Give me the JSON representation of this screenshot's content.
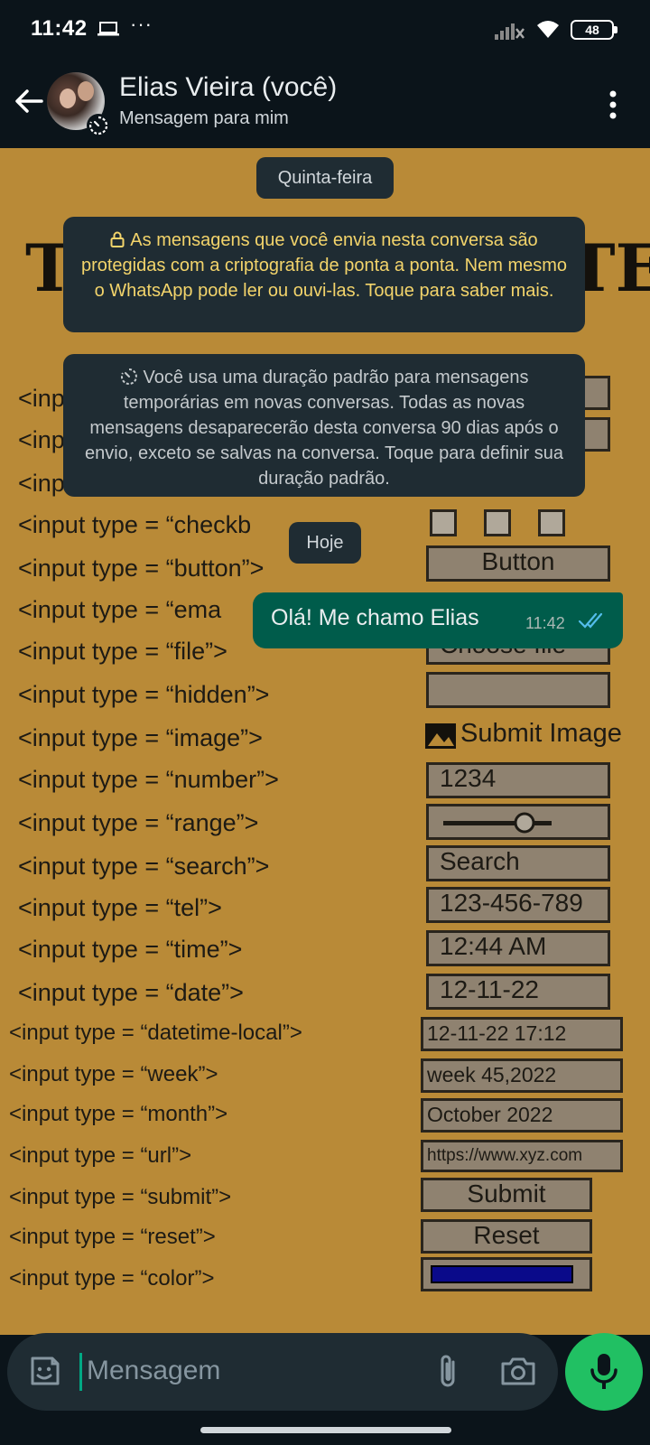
{
  "status_bar": {
    "time": "11:42",
    "dots": "···",
    "battery": "48",
    "icons": [
      "laptop-icon",
      "signal-off-icon",
      "wifi-icon",
      "battery-icon"
    ]
  },
  "header": {
    "contact_name": "Elias Vieira (você)",
    "subtitle": "Mensagem para mim",
    "icons": [
      "back-arrow-icon",
      "timer-icon",
      "more-vert-icon"
    ]
  },
  "chat": {
    "date_chip_1": "Quinta-feira",
    "encryption_notice": "As mensagens que você envia nesta conversa são protegidas com a criptografia de ponta a ponta. Nem mesmo o WhatsApp pode ler ou ouvi-las. Toque para saber mais.",
    "disappearing_notice": "Você usa uma duração padrão para mensagens temporárias em novas conversas. Todas as novas mensagens desaparecerão desta conversa 90 dias após o envio, exceto se salvas na conversa. Toque para definir sua duração padrão.",
    "date_chip_2": "Hoje",
    "messages": [
      {
        "text": "Olá! Me chamo Elias",
        "time": "11:42",
        "status": "read"
      }
    ]
  },
  "wallpaper": {
    "title_left": "T",
    "title_right": "TE",
    "rows": [
      "<inp",
      "<inp",
      "<inp",
      "<input type = “checkb",
      "<input type = “button”>",
      "<input type = “ema",
      "<input type = “file”>",
      "<input type = “hidden”>",
      "<input type = “image”>",
      "<input type = “number”>",
      "<input type = “range”>",
      "<input type = “search”>",
      "<input type = “tel”>",
      "<input type = “time”>",
      "<input type = “date”>",
      "<input type = “datetime-local”>",
      "<input type = “week”>",
      "<input type = “month”>",
      "<input type = “url”>",
      "<input type = “submit”>",
      "<input type = “reset”>",
      "<input type = “color”>"
    ],
    "boxes": {
      "button": "Button",
      "file": "Choose file",
      "image": "Submit Image",
      "number": "1234",
      "search": "Search",
      "tel": "123-456-789",
      "time": "12:44 AM",
      "date": "12-11-22",
      "datetime": "12-11-22 17:12",
      "week": "week 45,2022",
      "month": "October 2022",
      "url": "https://www.xyz.com",
      "submit": "Submit",
      "reset": "Reset"
    }
  },
  "composer": {
    "placeholder": "Mensagem",
    "icons": [
      "emoji-sticker-icon",
      "paperclip-icon",
      "camera-icon",
      "microphone-icon"
    ]
  },
  "colors": {
    "header_bg": "#0b141a",
    "wallpaper": "#b98a37",
    "outgoing_bubble": "#005c4b",
    "system_bubble": "#1f2c33",
    "notice_text": "#f3d46b",
    "mic_button": "#21c063",
    "read_ticks": "#53bdeb"
  }
}
